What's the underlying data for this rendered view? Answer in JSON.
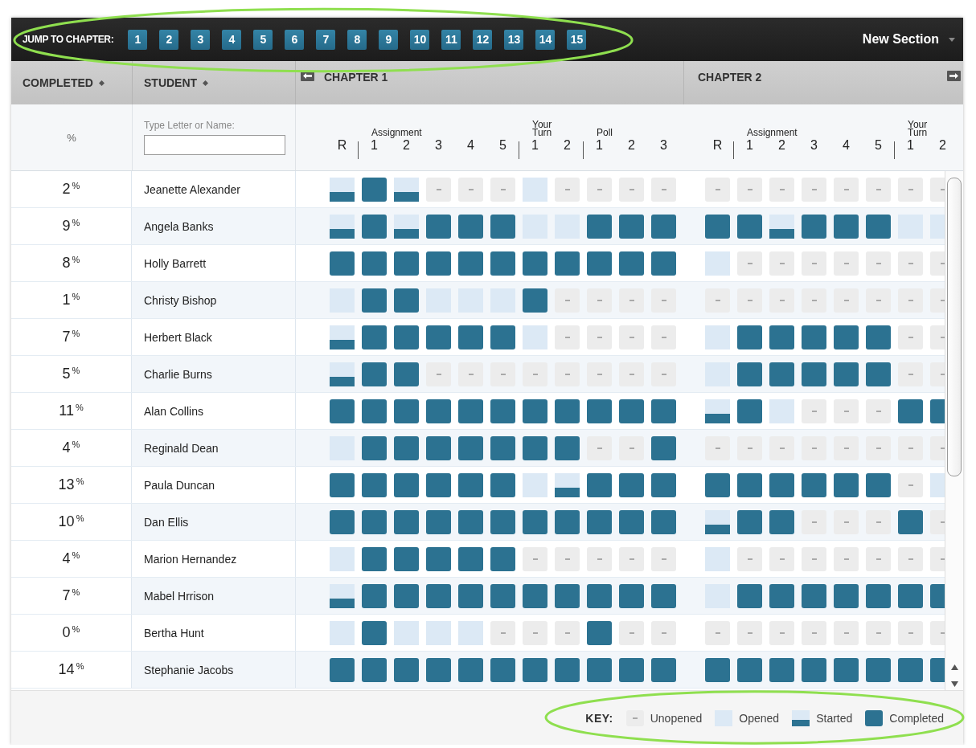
{
  "jump_bar": {
    "label": "JUMP TO CHAPTER:",
    "highlighted": true,
    "chapters": [
      "1",
      "2",
      "3",
      "4",
      "5",
      "6",
      "7",
      "8",
      "9",
      "10",
      "11",
      "12",
      "13",
      "14",
      "15"
    ],
    "section_menu": "New Section"
  },
  "header": {
    "completed": "COMPLETED",
    "student": "STUDENT",
    "chapters": [
      "CHAPTER 1",
      "CHAPTER 2"
    ]
  },
  "subheader": {
    "percent": "%",
    "search": {
      "label": "Type Letter or Name:"
    },
    "chapters": [
      {
        "groups": [
          {
            "columns": [
              "R"
            ]
          },
          {
            "label": "Assignment",
            "columns": [
              "1",
              "2",
              "3",
              "4",
              "5"
            ]
          },
          {
            "label": "Your Turn",
            "columns": [
              "1",
              "2"
            ]
          },
          {
            "label": "Poll",
            "columns": [
              "1",
              "2",
              "3"
            ]
          }
        ]
      },
      {
        "groups": [
          {
            "columns": [
              "R"
            ]
          },
          {
            "label": "Assignment",
            "columns": [
              "1",
              "2",
              "3",
              "4",
              "5"
            ]
          },
          {
            "label": "Your Turn",
            "columns": [
              "1",
              "2"
            ]
          }
        ]
      }
    ]
  },
  "rows": [
    {
      "completed": "2$^{%}$",
      "student": "Jeanette Alexander",
      "chapters": [
        [
          {
            "kind": "started"
          },
          {
            "kind": "completed"
          },
          {
            "kind": "started"
          },
          {
            "kind": "unopened"
          },
          {
            "kind": "unopened"
          },
          {
            "kind": "unopened"
          },
          {
            "kind": "opened"
          },
          {
            "kind": "unopened"
          },
          {
            "kind": "unopened"
          },
          {
            "kind": "unopened"
          },
          {
            "kind": "unopened"
          }
        ],
        [
          {
            "kind": "unopened"
          },
          {
            "kind": "unopened"
          },
          {
            "kind": "unopened"
          },
          {
            "kind": "unopened"
          },
          {
            "kind": "unopened"
          },
          {
            "kind": "unopened"
          },
          {
            "kind": "unopened"
          },
          {
            "kind": "unopened"
          }
        ]
      ]
    },
    {
      "completed": "9$^{%}$",
      "student": "Angela Banks",
      "chapters": [
        [
          {
            "kind": "started"
          },
          {
            "kind": "completed"
          },
          {
            "kind": "started"
          },
          {
            "kind": "completed"
          },
          {
            "kind": "completed"
          },
          {
            "kind": "completed"
          },
          {
            "kind": "opened"
          },
          {
            "kind": "opened"
          },
          {
            "kind": "completed"
          },
          {
            "kind": "completed"
          },
          {
            "kind": "completed"
          }
        ],
        [
          {
            "kind": "completed"
          },
          {
            "kind": "completed"
          },
          {
            "kind": "started"
          },
          {
            "kind": "completed"
          },
          {
            "kind": "completed"
          },
          {
            "kind": "completed"
          },
          {
            "kind": "opened"
          },
          {
            "kind": "opened"
          }
        ]
      ]
    },
    {
      "completed": "8$^{%}$",
      "student": "Holly Barrett",
      "chapters": [
        [
          {
            "kind": "completed"
          },
          {
            "kind": "completed"
          },
          {
            "kind": "completed"
          },
          {
            "kind": "completed"
          },
          {
            "kind": "completed"
          },
          {
            "kind": "completed"
          },
          {
            "kind": "completed"
          },
          {
            "kind": "completed"
          },
          {
            "kind": "completed"
          },
          {
            "kind": "completed"
          },
          {
            "kind": "completed"
          }
        ],
        [
          {
            "kind": "opened"
          },
          {
            "kind": "unopened"
          },
          {
            "kind": "unopened"
          },
          {
            "kind": "unopened"
          },
          {
            "kind": "unopened"
          },
          {
            "kind": "unopened"
          },
          {
            "kind": "unopened"
          },
          {
            "kind": "unopened"
          }
        ]
      ]
    },
    {
      "completed": "1$^{%}$",
      "student": "Christy Bishop",
      "chapters": [
        [
          {
            "kind": "opened"
          },
          {
            "kind": "completed"
          },
          {
            "kind": "completed"
          },
          {
            "kind": "opened"
          },
          {
            "kind": "opened"
          },
          {
            "kind": "opened"
          },
          {
            "kind": "completed"
          },
          {
            "kind": "unopened"
          },
          {
            "kind": "unopened"
          },
          {
            "kind": "unopened"
          },
          {
            "kind": "unopened"
          }
        ],
        [
          {
            "kind": "unopened"
          },
          {
            "kind": "unopened"
          },
          {
            "kind": "unopened"
          },
          {
            "kind": "unopened"
          },
          {
            "kind": "unopened"
          },
          {
            "kind": "unopened"
          },
          {
            "kind": "unopened"
          },
          {
            "kind": "unopened"
          }
        ]
      ]
    },
    {
      "completed": "7$^{%}$",
      "student": "Herbert Black",
      "chapters": [
        [
          {
            "kind": "started"
          },
          {
            "kind": "completed"
          },
          {
            "kind": "completed"
          },
          {
            "kind": "completed"
          },
          {
            "kind": "completed"
          },
          {
            "kind": "completed"
          },
          {
            "kind": "opened"
          },
          {
            "kind": "unopened"
          },
          {
            "kind": "unopened"
          },
          {
            "kind": "unopened"
          },
          {
            "kind": "unopened"
          }
        ],
        [
          {
            "kind": "opened"
          },
          {
            "kind": "completed"
          },
          {
            "kind": "completed"
          },
          {
            "kind": "completed"
          },
          {
            "kind": "completed"
          },
          {
            "kind": "completed"
          },
          {
            "kind": "unopened"
          },
          {
            "kind": "unopened"
          }
        ]
      ]
    },
    {
      "completed": "5$^{%}$",
      "student": "Charlie Burns",
      "chapters": [
        [
          {
            "kind": "started"
          },
          {
            "kind": "completed"
          },
          {
            "kind": "completed"
          },
          {
            "kind": "unopened"
          },
          {
            "kind": "unopened"
          },
          {
            "kind": "unopened"
          },
          {
            "kind": "unopened"
          },
          {
            "kind": "unopened"
          },
          {
            "kind": "unopened"
          },
          {
            "kind": "unopened"
          },
          {
            "kind": "unopened"
          }
        ],
        [
          {
            "kind": "opened"
          },
          {
            "kind": "completed"
          },
          {
            "kind": "completed"
          },
          {
            "kind": "completed"
          },
          {
            "kind": "completed"
          },
          {
            "kind": "completed"
          },
          {
            "kind": "unopened"
          },
          {
            "kind": "unopened"
          }
        ]
      ]
    },
    {
      "completed": "11$^{%}$",
      "student": "Alan Collins",
      "chapters": [
        [
          {
            "kind": "completed"
          },
          {
            "kind": "completed"
          },
          {
            "kind": "completed"
          },
          {
            "kind": "completed"
          },
          {
            "kind": "completed"
          },
          {
            "kind": "completed"
          },
          {
            "kind": "completed"
          },
          {
            "kind": "completed"
          },
          {
            "kind": "completed"
          },
          {
            "kind": "completed"
          },
          {
            "kind": "completed"
          }
        ],
        [
          {
            "kind": "started"
          },
          {
            "kind": "completed"
          },
          {
            "kind": "opened"
          },
          {
            "kind": "unopened"
          },
          {
            "kind": "unopened"
          },
          {
            "kind": "unopened"
          },
          {
            "kind": "completed"
          },
          {
            "kind": "completed"
          }
        ]
      ]
    },
    {
      "completed": "4$^{%}$",
      "student": "Reginald Dean",
      "chapters": [
        [
          {
            "kind": "opened"
          },
          {
            "kind": "completed"
          },
          {
            "kind": "completed"
          },
          {
            "kind": "completed"
          },
          {
            "kind": "completed"
          },
          {
            "kind": "completed"
          },
          {
            "kind": "completed"
          },
          {
            "kind": "completed"
          },
          {
            "kind": "unopened"
          },
          {
            "kind": "unopened"
          },
          {
            "kind": "completed"
          }
        ],
        [
          {
            "kind": "unopened"
          },
          {
            "kind": "unopened"
          },
          {
            "kind": "unopened"
          },
          {
            "kind": "unopened"
          },
          {
            "kind": "unopened"
          },
          {
            "kind": "unopened"
          },
          {
            "kind": "unopened"
          },
          {
            "kind": "unopened"
          }
        ]
      ]
    },
    {
      "completed": "13$^{%}$",
      "student": "Paula Duncan",
      "chapters": [
        [
          {
            "kind": "completed"
          },
          {
            "kind": "completed"
          },
          {
            "kind": "completed"
          },
          {
            "kind": "completed"
          },
          {
            "kind": "completed"
          },
          {
            "kind": "completed"
          },
          {
            "kind": "opened"
          },
          {
            "kind": "started"
          },
          {
            "kind": "completed"
          },
          {
            "kind": "completed"
          },
          {
            "kind": "completed"
          }
        ],
        [
          {
            "kind": "completed"
          },
          {
            "kind": "completed"
          },
          {
            "kind": "completed"
          },
          {
            "kind": "completed"
          },
          {
            "kind": "completed"
          },
          {
            "kind": "completed"
          },
          {
            "kind": "unopened"
          },
          {
            "kind": "opened"
          }
        ]
      ]
    },
    {
      "completed": "10$^{%}$",
      "student": "Dan Ellis",
      "chapters": [
        [
          {
            "kind": "completed"
          },
          {
            "kind": "completed"
          },
          {
            "kind": "completed"
          },
          {
            "kind": "completed"
          },
          {
            "kind": "completed"
          },
          {
            "kind": "completed"
          },
          {
            "kind": "completed"
          },
          {
            "kind": "completed"
          },
          {
            "kind": "completed"
          },
          {
            "kind": "completed"
          },
          {
            "kind": "completed"
          }
        ],
        [
          {
            "kind": "started"
          },
          {
            "kind": "completed"
          },
          {
            "kind": "completed"
          },
          {
            "kind": "unopened"
          },
          {
            "kind": "unopened"
          },
          {
            "kind": "unopened"
          },
          {
            "kind": "completed"
          },
          {
            "kind": "unopened"
          }
        ]
      ]
    },
    {
      "completed": "4$^{%}$",
      "student": "Marion Hernandez",
      "chapters": [
        [
          {
            "kind": "opened"
          },
          {
            "kind": "completed"
          },
          {
            "kind": "completed"
          },
          {
            "kind": "completed"
          },
          {
            "kind": "completed"
          },
          {
            "kind": "completed"
          },
          {
            "kind": "unopened"
          },
          {
            "kind": "unopened"
          },
          {
            "kind": "unopened"
          },
          {
            "kind": "unopened"
          },
          {
            "kind": "unopened"
          }
        ],
        [
          {
            "kind": "opened"
          },
          {
            "kind": "unopened"
          },
          {
            "kind": "unopened"
          },
          {
            "kind": "unopened"
          },
          {
            "kind": "unopened"
          },
          {
            "kind": "unopened"
          },
          {
            "kind": "unopened"
          },
          {
            "kind": "unopened"
          }
        ]
      ]
    },
    {
      "completed": "7$^{%}$",
      "student": "Mabel Hrrison",
      "chapters": [
        [
          {
            "kind": "started"
          },
          {
            "kind": "completed"
          },
          {
            "kind": "completed"
          },
          {
            "kind": "completed"
          },
          {
            "kind": "completed"
          },
          {
            "kind": "completed"
          },
          {
            "kind": "completed"
          },
          {
            "kind": "completed"
          },
          {
            "kind": "completed"
          },
          {
            "kind": "completed"
          },
          {
            "kind": "completed"
          }
        ],
        [
          {
            "kind": "opened"
          },
          {
            "kind": "completed"
          },
          {
            "kind": "completed"
          },
          {
            "kind": "completed"
          },
          {
            "kind": "completed"
          },
          {
            "kind": "completed"
          },
          {
            "kind": "completed"
          },
          {
            "kind": "completed"
          }
        ]
      ]
    },
    {
      "completed": "0$^{%}$",
      "student": "Bertha Hunt",
      "chapters": [
        [
          {
            "kind": "opened"
          },
          {
            "kind": "completed"
          },
          {
            "kind": "opened"
          },
          {
            "kind": "opened"
          },
          {
            "kind": "opened"
          },
          {
            "kind": "unopened"
          },
          {
            "kind": "unopened"
          },
          {
            "kind": "unopened"
          },
          {
            "kind": "completed"
          },
          {
            "kind": "unopened"
          },
          {
            "kind": "unopened"
          }
        ],
        [
          {
            "kind": "unopened"
          },
          {
            "kind": "unopened"
          },
          {
            "kind": "unopened"
          },
          {
            "kind": "unopened"
          },
          {
            "kind": "unopened"
          },
          {
            "kind": "unopened"
          },
          {
            "kind": "unopened"
          },
          {
            "kind": "unopened"
          }
        ]
      ]
    },
    {
      "completed": "14$^{%}$",
      "student": "Stephanie Jacobs",
      "chapters": [
        [
          {
            "kind": "completed"
          },
          {
            "kind": "completed"
          },
          {
            "kind": "completed"
          },
          {
            "kind": "completed"
          },
          {
            "kind": "completed"
          },
          {
            "kind": "completed"
          },
          {
            "kind": "completed"
          },
          {
            "kind": "completed"
          },
          {
            "kind": "completed"
          },
          {
            "kind": "completed"
          },
          {
            "kind": "completed"
          }
        ],
        [
          {
            "kind": "completed"
          },
          {
            "kind": "completed"
          },
          {
            "kind": "completed"
          },
          {
            "kind": "completed"
          },
          {
            "kind": "completed"
          },
          {
            "kind": "completed"
          },
          {
            "kind": "completed"
          },
          {
            "kind": "completed"
          }
        ]
      ]
    }
  ],
  "key": {
    "label": "KEY:",
    "highlighted": true,
    "items": [
      {
        "kind": "unopened",
        "label": "Unopened"
      },
      {
        "kind": "opened",
        "label": "Opened"
      },
      {
        "kind": "started",
        "label": "Started"
      },
      {
        "kind": "completed",
        "label": "Completed"
      }
    ]
  }
}
